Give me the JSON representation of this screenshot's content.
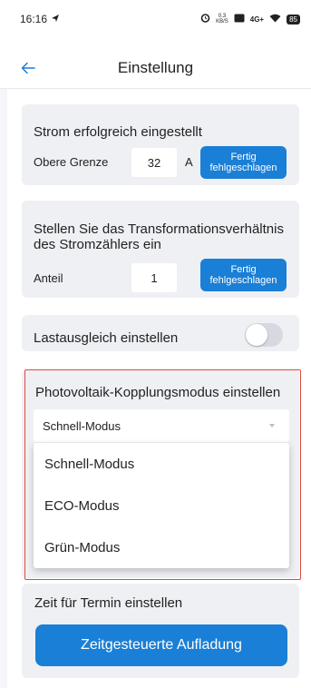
{
  "status_bar": {
    "time": "16:16",
    "speed_top": "0.3",
    "speed_bottom": "KB/S",
    "network": "4G+",
    "battery": "85"
  },
  "header": {
    "title": "Einstellung"
  },
  "current_card": {
    "title": "Strom erfolgreich eingestellt",
    "label": "Obere Grenze",
    "value": "32",
    "unit": "A",
    "button_line1": "Fertig",
    "button_line2": "fehlgeschlagen"
  },
  "ratio_card": {
    "title_line1": "Stellen Sie das Transformationsverhältnis",
    "title_line2": "des Stromzählers ein",
    "label": "Anteil",
    "value": "1",
    "button_line1": "Fertig",
    "button_line2": "fehlgeschlagen"
  },
  "load_balance": {
    "label": "Lastausgleich einstellen",
    "enabled": false
  },
  "pv_mode": {
    "title": "Photovoltaik-Kopplungsmodus einstellen",
    "selected": "Schnell-Modus",
    "options": [
      "Schnell-Modus",
      "ECO-Modus",
      "Grün-Modus"
    ]
  },
  "schedule": {
    "title": "Zeit für Termin einstellen",
    "button": "Zeitgesteuerte Aufladung"
  },
  "colors": {
    "accent": "#1a7fd6",
    "highlight_border": "#e0493c",
    "card_bg": "#eef0f4"
  }
}
